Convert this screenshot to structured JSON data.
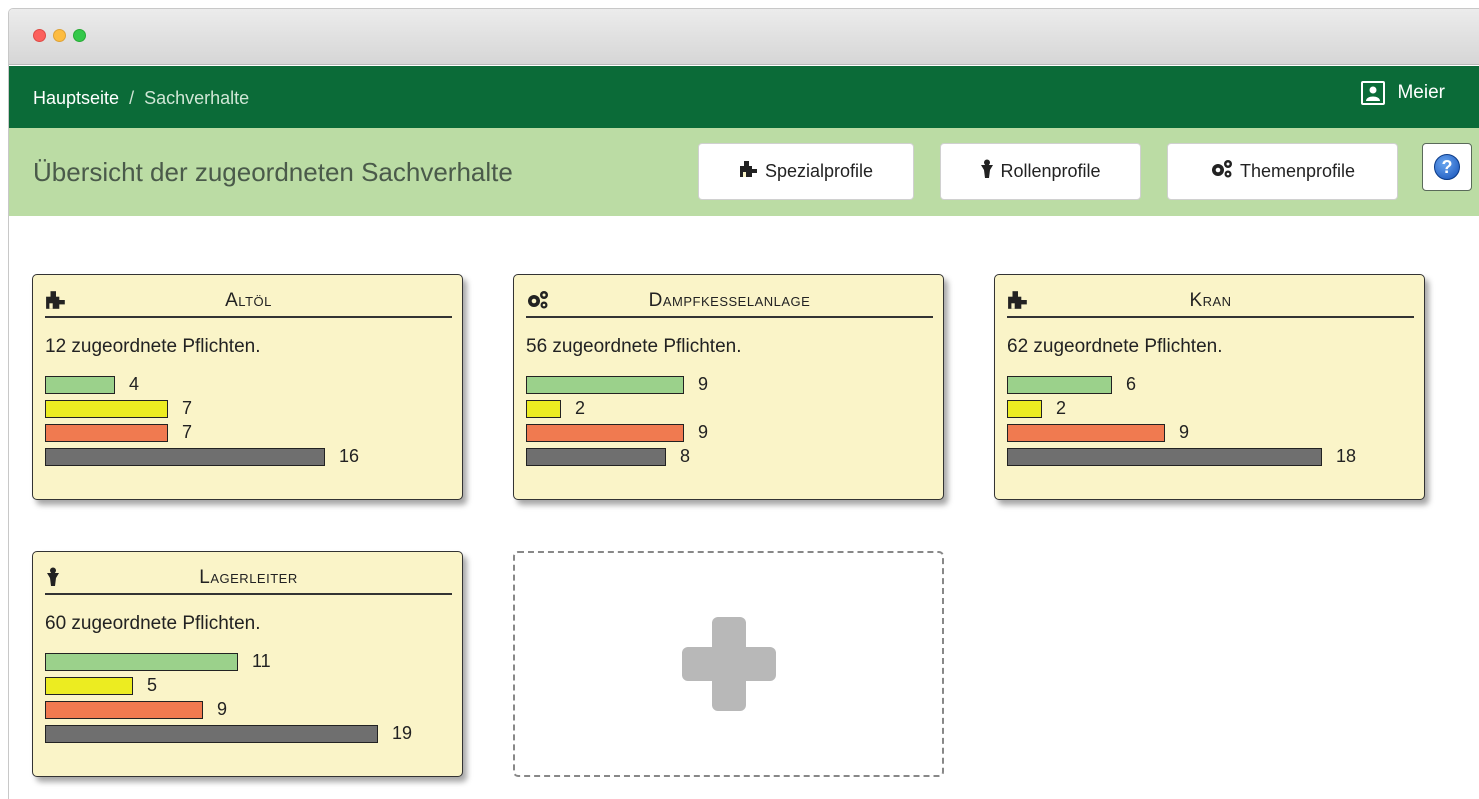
{
  "breadcrumb": {
    "home": "Hauptseite",
    "separator": "/",
    "current": "Sachverhalte"
  },
  "user": {
    "name": "Meier",
    "icon": "user-icon"
  },
  "subbar": {
    "title": "Übersicht der zugeordneten Sachverhalte",
    "buttons": [
      {
        "label": "Spezialprofile",
        "icon": "puzzle-icon"
      },
      {
        "label": "Rollenprofile",
        "icon": "person-icon"
      },
      {
        "label": "Themenprofile",
        "icon": "gears-icon"
      }
    ],
    "help_icon": "help-icon"
  },
  "colors": {
    "green": "#9bd18b",
    "yellow": "#ecec21",
    "red": "#f07a50",
    "gray": "#6f6f6f",
    "nav": "#0b6b38",
    "subbar": "#bbdca4"
  },
  "cards": [
    {
      "title": "Altöl",
      "icon": "puzzle-icon",
      "count_text": "12 zugeordnete Pflichten.",
      "bars": [
        4,
        7,
        7,
        16
      ]
    },
    {
      "title": "Dampfkesselanlage",
      "icon": "gears-icon",
      "count_text": "56 zugeordnete Pflichten.",
      "bars": [
        9,
        2,
        9,
        8
      ]
    },
    {
      "title": "Kran",
      "icon": "puzzle-icon",
      "count_text": "62 zugeordnete Pflichten.",
      "bars": [
        6,
        2,
        9,
        18
      ]
    },
    {
      "title": "Lagerleiter",
      "icon": "person-icon",
      "count_text": "60 zugeordnete Pflichten.",
      "bars": [
        11,
        5,
        9,
        19
      ]
    }
  ],
  "add_card": {
    "icon": "plus-icon"
  }
}
